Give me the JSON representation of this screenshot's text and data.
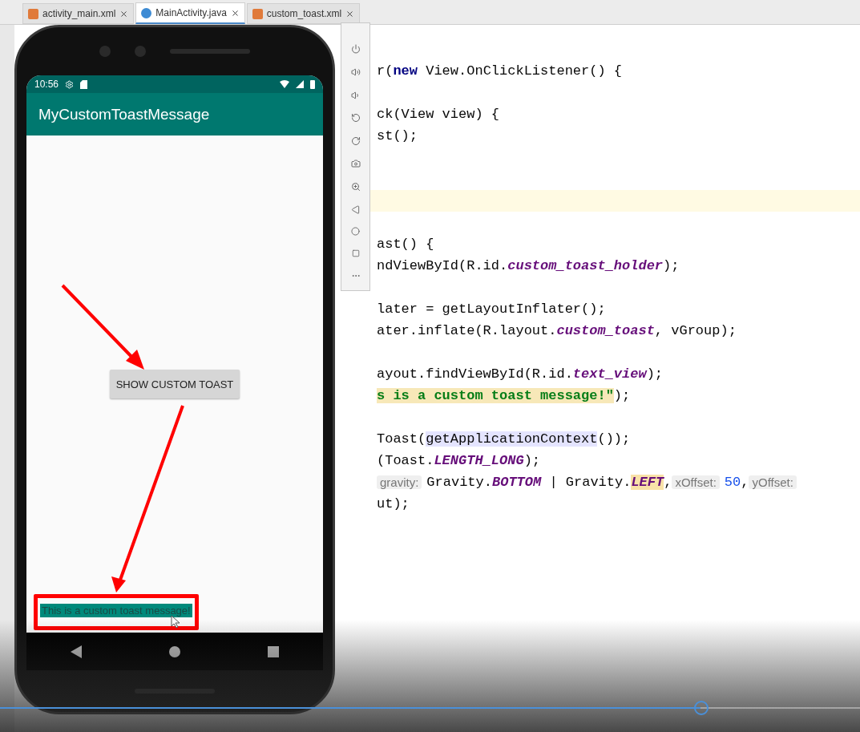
{
  "editor_tabs": [
    {
      "label": "activity_main.xml",
      "kind": "xml",
      "selected": false
    },
    {
      "label": "MainActivity.java",
      "kind": "java",
      "selected": true
    },
    {
      "label": "custom_toast.xml",
      "kind": "xml",
      "selected": false
    }
  ],
  "emulator": {
    "time": "10:56",
    "app_title": "MyCustomToastMessage",
    "button": "SHOW CUSTOM TOAST",
    "toast": "This is a custom toast message!"
  },
  "code": {
    "lines": [
      {
        "kind": "code",
        "segments": [
          {
            "t": "r(",
            "kind": "plain"
          },
          {
            "t": "new",
            "kind": "keyword"
          },
          {
            "t": " View.OnClickListener() {",
            "kind": "plain"
          }
        ]
      },
      {
        "kind": "blank"
      },
      {
        "kind": "code",
        "segments": [
          {
            "t": "ck(View view) {",
            "kind": "plain"
          }
        ]
      },
      {
        "kind": "code",
        "segments": [
          {
            "t": "st();",
            "kind": "plain"
          }
        ]
      },
      {
        "kind": "blank"
      },
      {
        "kind": "blank"
      },
      {
        "kind": "current"
      },
      {
        "kind": "blank"
      },
      {
        "kind": "code",
        "segments": [
          {
            "t": "ast() {",
            "kind": "plain"
          }
        ]
      },
      {
        "kind": "code",
        "segments": [
          {
            "t": "ndViewById(R.id.",
            "kind": "plain"
          },
          {
            "t": "custom_toast_holder",
            "kind": "field"
          },
          {
            "t": ");",
            "kind": "plain"
          }
        ]
      },
      {
        "kind": "blank"
      },
      {
        "kind": "code",
        "segments": [
          {
            "t": "later = getLayoutInflater();",
            "kind": "plain"
          }
        ]
      },
      {
        "kind": "code",
        "segments": [
          {
            "t": "ater.inflate(R.layout.",
            "kind": "plain"
          },
          {
            "t": "custom_toast",
            "kind": "field"
          },
          {
            "t": ", vGroup);",
            "kind": "plain"
          }
        ]
      },
      {
        "kind": "blank"
      },
      {
        "kind": "code",
        "segments": [
          {
            "t": "ayout.findViewById(R.id.",
            "kind": "plain"
          },
          {
            "t": "text_view",
            "kind": "field"
          },
          {
            "t": ");",
            "kind": "plain"
          }
        ]
      },
      {
        "kind": "code",
        "segments": [
          {
            "t": "s is a custom toast message!\"",
            "kind": "string"
          },
          {
            "t": ");",
            "kind": "plain"
          }
        ]
      },
      {
        "kind": "blank"
      },
      {
        "kind": "code",
        "segments": [
          {
            "t": "Toast(",
            "kind": "plain"
          },
          {
            "t": "getApplicationContext",
            "kind": "usage"
          },
          {
            "t": "());",
            "kind": "plain"
          }
        ]
      },
      {
        "kind": "code",
        "segments": [
          {
            "t": "(Toast.",
            "kind": "plain"
          },
          {
            "t": "LENGTH_LONG",
            "kind": "field"
          },
          {
            "t": ");",
            "kind": "plain"
          }
        ]
      },
      {
        "kind": "code",
        "segments": [
          {
            "t": "gravity:",
            "kind": "hint"
          },
          {
            "t": "Gravity.",
            "kind": "plain"
          },
          {
            "t": "BOTTOM",
            "kind": "field"
          },
          {
            "t": " | Gravity.",
            "kind": "plain"
          },
          {
            "t": "LEFT",
            "kind": "match"
          },
          {
            "t": ",",
            "kind": "plain"
          },
          {
            "t": "xOffset:",
            "kind": "hint"
          },
          {
            "t": "50",
            "kind": "number"
          },
          {
            "t": ",",
            "kind": "plain"
          },
          {
            "t": "yOffset:",
            "kind": "hint"
          }
        ]
      },
      {
        "kind": "code",
        "segments": [
          {
            "t": "ut);",
            "kind": "plain"
          }
        ]
      }
    ]
  },
  "video_player": {
    "level": 0.815
  }
}
